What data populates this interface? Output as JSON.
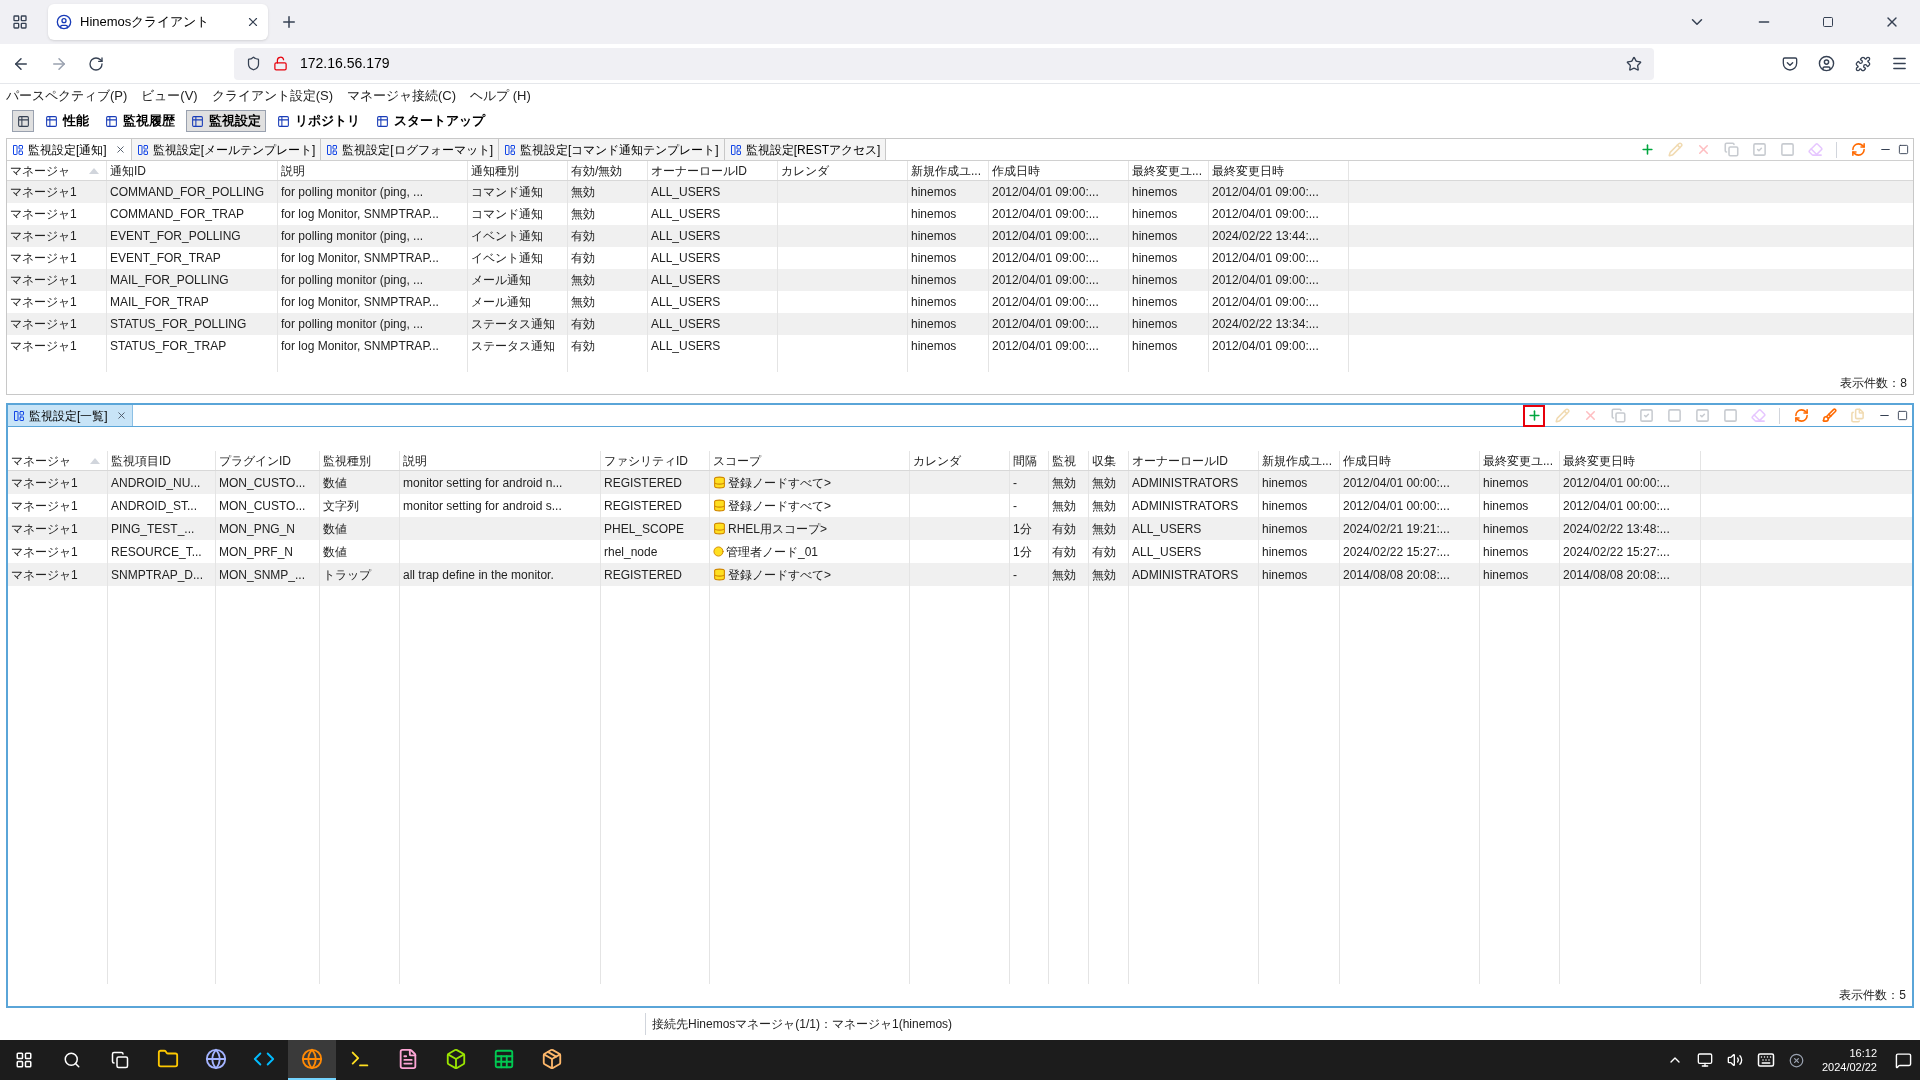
{
  "browser": {
    "tab_title": "Hinemosクライアント",
    "address": "172.16.56.179"
  },
  "menu": [
    "パースペクティブ(P)",
    "ビュー(V)",
    "クライアント設定(S)",
    "マネージャ接続(C)",
    "ヘルプ (H)"
  ],
  "perspectives": [
    {
      "label": "性能",
      "selected": false
    },
    {
      "label": "監視履歴",
      "selected": false
    },
    {
      "label": "監視設定",
      "selected": true
    },
    {
      "label": "リポジトリ",
      "selected": false
    },
    {
      "label": "スタートアップ",
      "selected": false
    }
  ],
  "upper_view": {
    "tabs": [
      {
        "label": "監視設定[通知]",
        "selected": true
      },
      {
        "label": "監視設定[メールテンプレート]",
        "selected": false
      },
      {
        "label": "監視設定[ログフォーマット]",
        "selected": false
      },
      {
        "label": "監視設定[コマンド通知テンプレート]",
        "selected": false
      },
      {
        "label": "監視設定[RESTアクセス]",
        "selected": false
      }
    ],
    "toolbar": [
      {
        "kind": "add",
        "disabled": false
      },
      {
        "kind": "edit",
        "disabled": true
      },
      {
        "kind": "delete",
        "disabled": true
      },
      {
        "kind": "copy",
        "disabled": true
      },
      {
        "kind": "check",
        "disabled": true
      },
      {
        "kind": "uncheck",
        "disabled": true
      },
      {
        "kind": "clear",
        "disabled": true
      },
      {
        "kind": "separator"
      },
      {
        "kind": "refresh",
        "disabled": false
      }
    ],
    "columns": [
      {
        "label": "マネージャ",
        "sorted": true
      },
      {
        "label": "通知ID",
        "sorted": false
      },
      {
        "label": "説明",
        "sorted": false
      },
      {
        "label": "通知種別",
        "sorted": false
      },
      {
        "label": "有効/無効",
        "sorted": false
      },
      {
        "label": "オーナーロールID",
        "sorted": false
      },
      {
        "label": "カレンダ",
        "sorted": false
      },
      {
        "label": "新規作成ユ...",
        "sorted": false
      },
      {
        "label": "作成日時",
        "sorted": false
      },
      {
        "label": "最終変更ユ...",
        "sorted": false
      },
      {
        "label": "最終変更日時",
        "sorted": false
      }
    ],
    "rows": [
      [
        "マネージャ1",
        "COMMAND_FOR_POLLING",
        "for polling monitor (ping, ...",
        "コマンド通知",
        "無効",
        "ALL_USERS",
        null,
        "hinemos",
        "2012/04/01 09:00:...",
        "hinemos",
        "2012/04/01 09:00:..."
      ],
      [
        "マネージャ1",
        "COMMAND_FOR_TRAP",
        "for log Monitor, SNMPTRAP...",
        "コマンド通知",
        "無効",
        "ALL_USERS",
        null,
        "hinemos",
        "2012/04/01 09:00:...",
        "hinemos",
        "2012/04/01 09:00:..."
      ],
      [
        "マネージャ1",
        "EVENT_FOR_POLLING",
        "for polling monitor (ping, ...",
        "イベント通知",
        "有効",
        "ALL_USERS",
        null,
        "hinemos",
        "2012/04/01 09:00:...",
        "hinemos",
        "2024/02/22 13:44:..."
      ],
      [
        "マネージャ1",
        "EVENT_FOR_TRAP",
        "for log Monitor, SNMPTRAP...",
        "イベント通知",
        "有効",
        "ALL_USERS",
        null,
        "hinemos",
        "2012/04/01 09:00:...",
        "hinemos",
        "2012/04/01 09:00:..."
      ],
      [
        "マネージャ1",
        "MAIL_FOR_POLLING",
        "for polling monitor (ping, ...",
        "メール通知",
        "無効",
        "ALL_USERS",
        null,
        "hinemos",
        "2012/04/01 09:00:...",
        "hinemos",
        "2012/04/01 09:00:..."
      ],
      [
        "マネージャ1",
        "MAIL_FOR_TRAP",
        "for log Monitor, SNMPTRAP...",
        "メール通知",
        "無効",
        "ALL_USERS",
        null,
        "hinemos",
        "2012/04/01 09:00:...",
        "hinemos",
        "2012/04/01 09:00:..."
      ],
      [
        "マネージャ1",
        "STATUS_FOR_POLLING",
        "for polling monitor (ping, ...",
        "ステータス通知",
        "有効",
        "ALL_USERS",
        null,
        "hinemos",
        "2012/04/01 09:00:...",
        "hinemos",
        "2024/02/22 13:34:..."
      ],
      [
        "マネージャ1",
        "STATUS_FOR_TRAP",
        "for log Monitor, SNMPTRAP...",
        "ステータス通知",
        "有効",
        "ALL_USERS",
        null,
        "hinemos",
        "2012/04/01 09:00:...",
        "hinemos",
        "2012/04/01 09:00:..."
      ]
    ],
    "footer": "表示件数：8"
  },
  "lower_view": {
    "tabs": [
      {
        "label": "監視設定[一覧]",
        "selected": true
      }
    ],
    "toolbar": [
      {
        "kind": "add",
        "disabled": false,
        "highlighted": true
      },
      {
        "kind": "edit",
        "disabled": true
      },
      {
        "kind": "delete",
        "disabled": true
      },
      {
        "kind": "copy",
        "disabled": true
      },
      {
        "kind": "check",
        "disabled": true
      },
      {
        "kind": "uncheck",
        "disabled": true
      },
      {
        "kind": "check",
        "disabled": true
      },
      {
        "kind": "uncheck",
        "disabled": true
      },
      {
        "kind": "clear",
        "disabled": true
      },
      {
        "kind": "separator"
      },
      {
        "kind": "refresh",
        "disabled": false
      },
      {
        "kind": "brush",
        "disabled": false
      },
      {
        "kind": "paste",
        "disabled": true
      }
    ],
    "columns": [
      {
        "label": "マネージャ",
        "sorted": true
      },
      {
        "label": "監視項目ID",
        "sorted": false
      },
      {
        "label": "プラグインID",
        "sorted": false
      },
      {
        "label": "監視種別",
        "sorted": false
      },
      {
        "label": "説明",
        "sorted": false
      },
      {
        "label": "ファシリティID",
        "sorted": false
      },
      {
        "label": "スコープ",
        "sorted": false
      },
      {
        "label": "カレンダ",
        "sorted": false
      },
      {
        "label": "間隔",
        "sorted": false
      },
      {
        "label": "監視",
        "sorted": false
      },
      {
        "label": "収集",
        "sorted": false
      },
      {
        "label": "オーナーロールID",
        "sorted": false
      },
      {
        "label": "新規作成ユ...",
        "sorted": false
      },
      {
        "label": "作成日時",
        "sorted": false
      },
      {
        "label": "最終変更ユ...",
        "sorted": false
      },
      {
        "label": "最終変更日時",
        "sorted": false
      }
    ],
    "rows": [
      [
        "マネージャ1",
        "ANDROID_NU...",
        "MON_CUSTO...",
        "数値",
        "monitor setting for android n...",
        "REGISTERED",
        {
          "kind": "group",
          "text": "登録ノードすべて>"
        },
        null,
        "-",
        "無効",
        "無効",
        "ADMINISTRATORS",
        "hinemos",
        "2012/04/01 00:00:...",
        "hinemos",
        "2012/04/01 00:00:..."
      ],
      [
        "マネージャ1",
        "ANDROID_ST...",
        "MON_CUSTO...",
        "文字列",
        "monitor setting for android s...",
        "REGISTERED",
        {
          "kind": "group",
          "text": "登録ノードすべて>"
        },
        null,
        "-",
        "無効",
        "無効",
        "ADMINISTRATORS",
        "hinemos",
        "2012/04/01 00:00:...",
        "hinemos",
        "2012/04/01 00:00:..."
      ],
      [
        "マネージャ1",
        "PING_TEST_...",
        "MON_PNG_N",
        "数値",
        null,
        "PHEL_SCOPE",
        {
          "kind": "group",
          "text": "RHEL用スコープ>"
        },
        null,
        "1分",
        "有効",
        "無効",
        "ALL_USERS",
        "hinemos",
        "2024/02/21 19:21:...",
        "hinemos",
        "2024/02/22 13:48:..."
      ],
      [
        "マネージャ1",
        "RESOURCE_T...",
        "MON_PRF_N",
        "数値",
        null,
        "rhel_node",
        {
          "kind": "node",
          "text": "管理者ノード_01"
        },
        null,
        "1分",
        "有効",
        "有効",
        "ALL_USERS",
        "hinemos",
        "2024/02/22 15:27:...",
        "hinemos",
        "2024/02/22 15:27:..."
      ],
      [
        "マネージャ1",
        "SNMPTRAP_D...",
        "MON_SNMP_...",
        "トラップ",
        "all trap define in the monitor.",
        "REGISTERED",
        {
          "kind": "group",
          "text": "登録ノードすべて>"
        },
        null,
        "-",
        "無効",
        "無効",
        "ADMINISTRATORS",
        "hinemos",
        "2014/08/08 20:08:...",
        "hinemos",
        "2014/08/08 20:08:..."
      ]
    ],
    "footer": "表示件数：5"
  },
  "status_bar": "接続先Hinemosマネージャ(1/1)：マネージャ1(hinemos)",
  "taskbar": {
    "apps": [
      {
        "kind": "folder",
        "active": false
      },
      {
        "kind": "eclipse",
        "active": false
      },
      {
        "kind": "code",
        "active": false
      },
      {
        "kind": "firefox",
        "active": true
      },
      {
        "kind": "terminal",
        "active": false
      },
      {
        "kind": "notepad",
        "active": false
      },
      {
        "kind": "vm",
        "active": false
      },
      {
        "kind": "excel",
        "active": false
      },
      {
        "kind": "installer",
        "active": false
      }
    ],
    "time": "16:12",
    "date": "2024/02/22"
  }
}
